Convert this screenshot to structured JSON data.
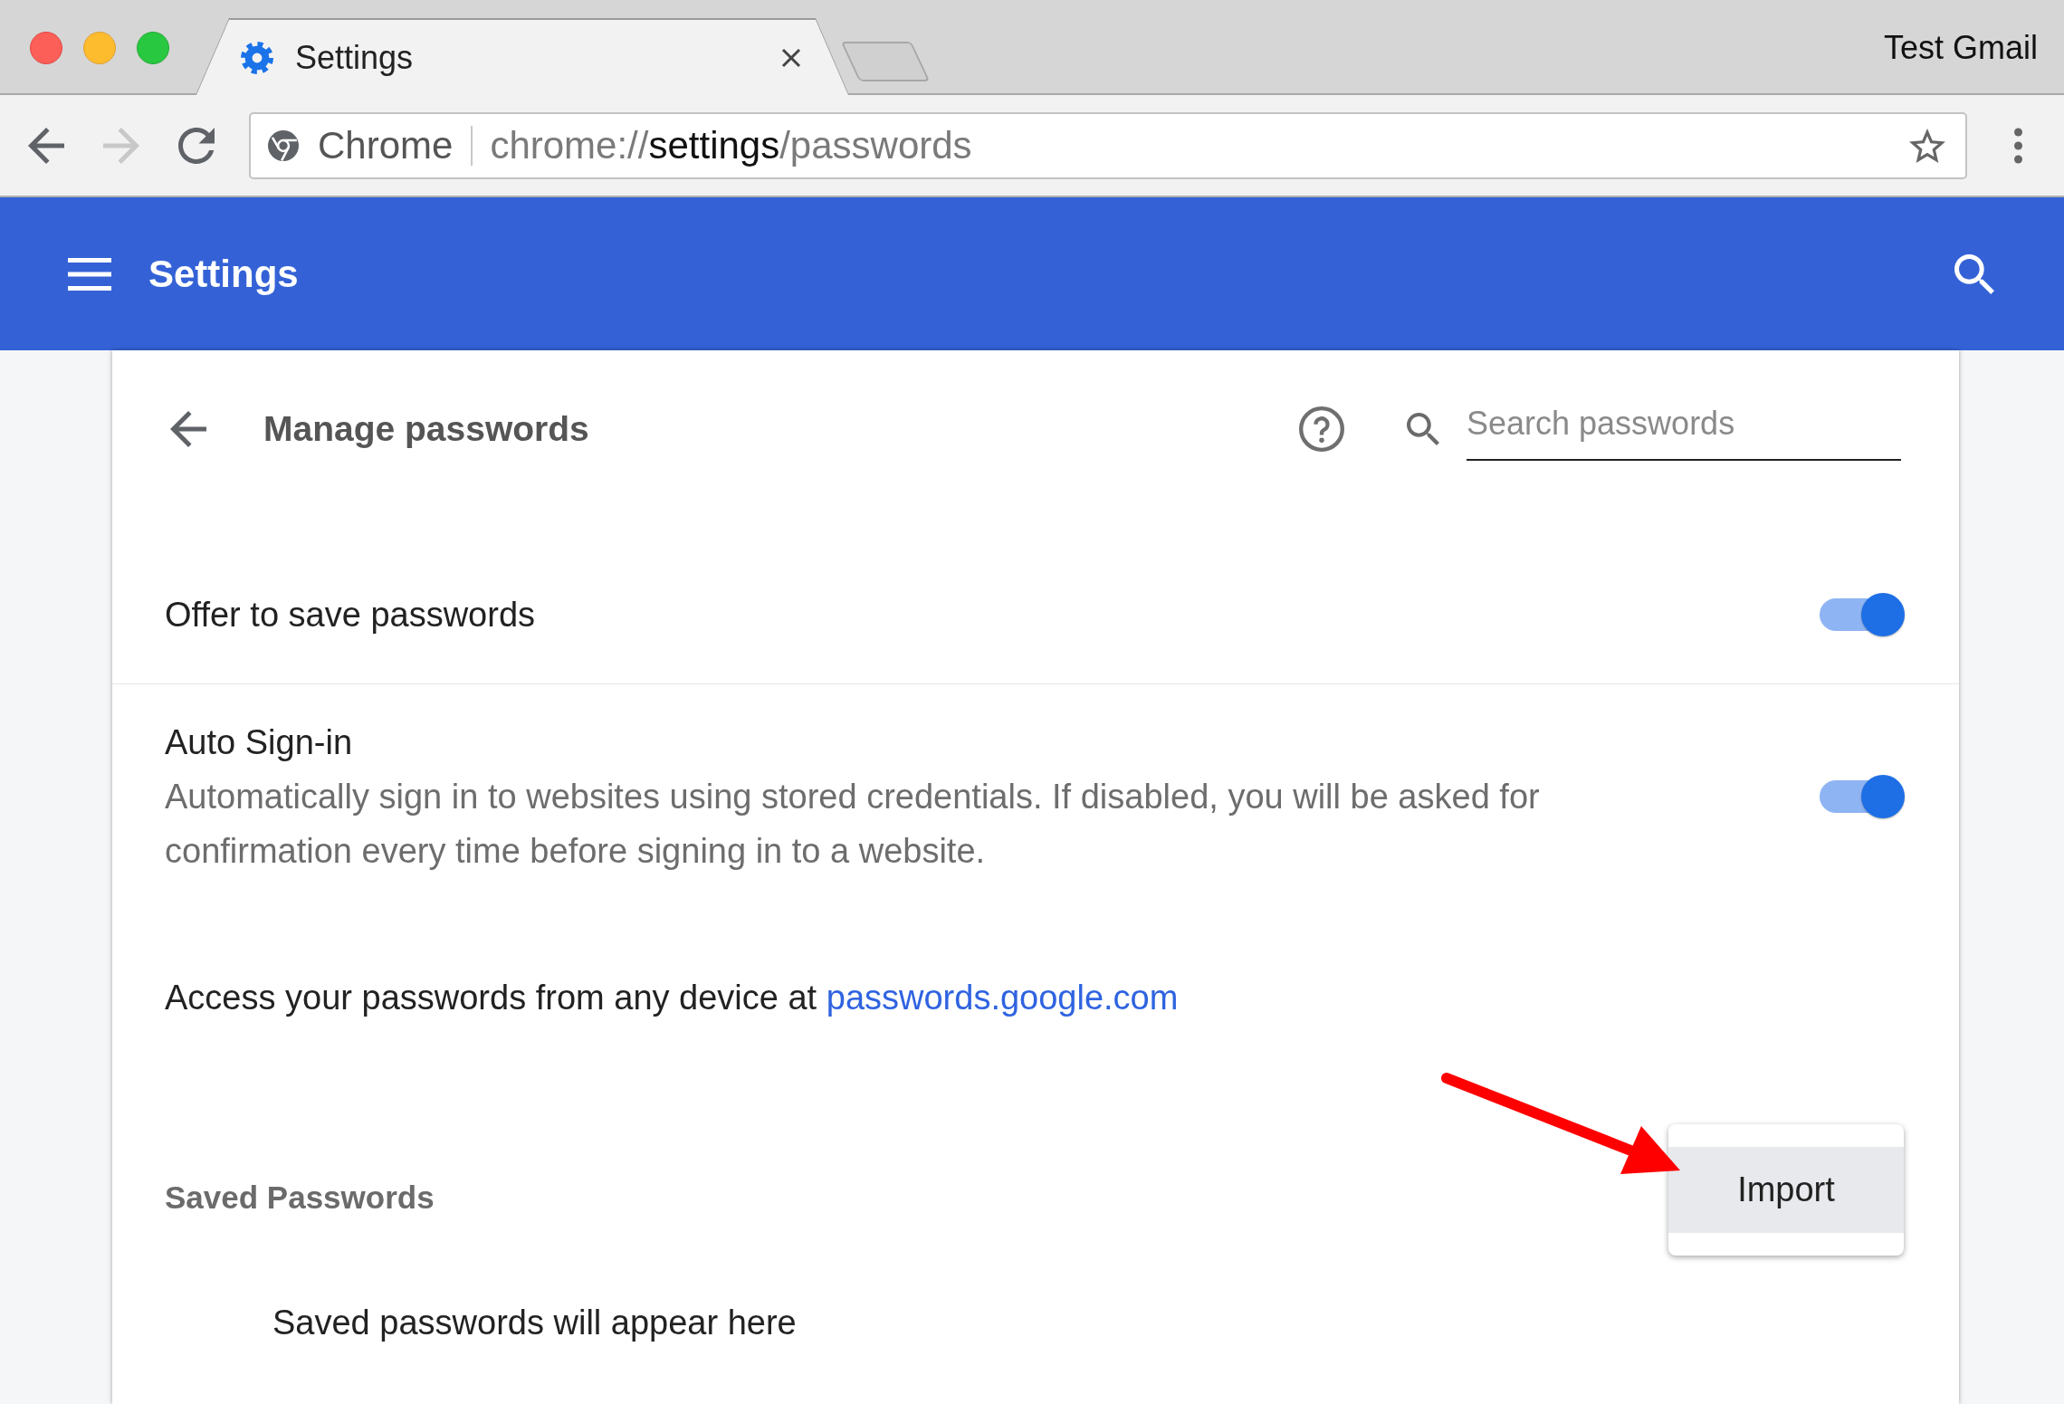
{
  "window": {
    "profile": "Test Gmail"
  },
  "tabs": [
    {
      "label": "Settings",
      "selected": true
    }
  ],
  "toolbar": {
    "nav_buttons": [
      {
        "kind": "back",
        "disabled": false
      },
      {
        "kind": "forward",
        "disabled": true
      },
      {
        "kind": "reload",
        "disabled": false
      }
    ],
    "address_bar": {
      "site_label": "Chrome",
      "url": {
        "scheme": "chrome://",
        "host": "settings",
        "path": "/passwords"
      }
    }
  },
  "header": {
    "title": "Settings"
  },
  "page": {
    "title": "Manage passwords",
    "search": {
      "placeholder": "Search passwords"
    }
  },
  "settings": [
    {
      "label": "Offer to save passwords",
      "on": true
    },
    {
      "label": "Auto Sign-in",
      "description": "Automatically sign in to websites using stored credentials. If disabled, you will be asked for confirmation every time before signing in to a website.",
      "on": true
    }
  ],
  "access_note": {
    "text": "Access your passwords from any device at",
    "link": "passwords.google.com"
  },
  "saved_passwords": {
    "heading": "Saved Passwords",
    "empty_text": "Saved passwords will appear here"
  },
  "menu": {
    "items": [
      {
        "label": "Import",
        "selected": true
      }
    ]
  }
}
